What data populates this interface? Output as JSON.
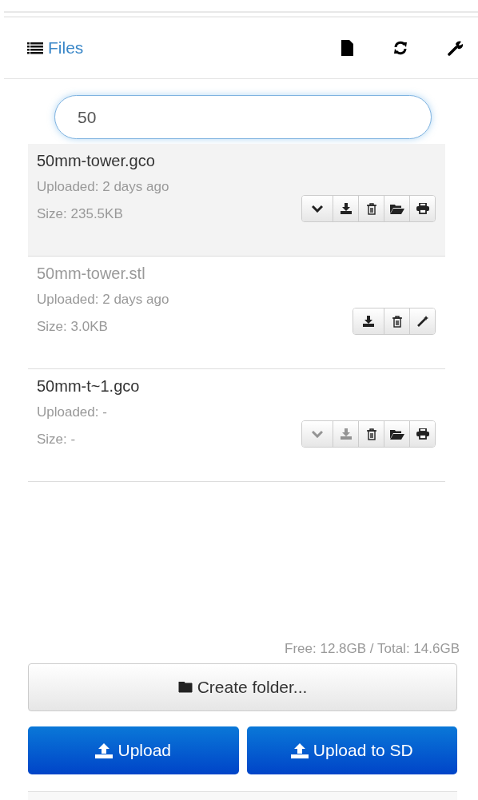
{
  "header": {
    "title": "Files"
  },
  "search": {
    "value": "50"
  },
  "files": [
    {
      "name": "50mm-tower.gco",
      "kind": "machinecode",
      "selected": true,
      "uploaded": "Uploaded: 2 days ago",
      "size": "Size: 235.5KB",
      "actions": [
        {
          "kind": "details",
          "disabled": false
        },
        {
          "kind": "download",
          "disabled": false
        },
        {
          "kind": "remove",
          "disabled": false
        },
        {
          "kind": "load",
          "disabled": false
        },
        {
          "kind": "print",
          "disabled": false
        }
      ]
    },
    {
      "name": "50mm-tower.stl",
      "kind": "model",
      "selected": false,
      "uploaded": "Uploaded: 2 days ago",
      "size": "Size: 3.0KB",
      "actions": [
        {
          "kind": "download",
          "disabled": false
        },
        {
          "kind": "remove",
          "disabled": false
        },
        {
          "kind": "slice",
          "disabled": false
        }
      ]
    },
    {
      "name": "50mm-t~1.gco",
      "kind": "machinecode",
      "selected": false,
      "uploaded": "Uploaded: -",
      "size": "Size: -",
      "actions": [
        {
          "kind": "details",
          "disabled": true
        },
        {
          "kind": "download",
          "disabled": true
        },
        {
          "kind": "remove",
          "disabled": false
        },
        {
          "kind": "load",
          "disabled": false
        },
        {
          "kind": "print",
          "disabled": false
        }
      ]
    }
  ],
  "storage": "Free: 12.8GB / Total: 14.6GB",
  "create_folder": "Create folder...",
  "uploads": [
    {
      "label": "Upload"
    },
    {
      "label": "Upload to SD"
    }
  ]
}
